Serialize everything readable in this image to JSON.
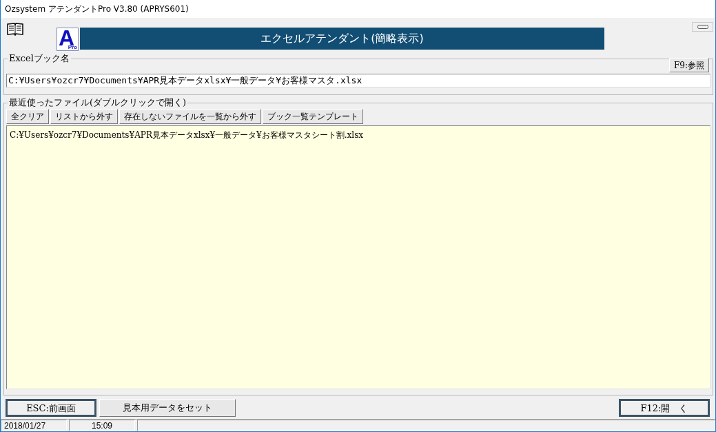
{
  "window": {
    "title": "Ozsystem アテンダントPro V3.80 (APRYS601)"
  },
  "logo": {
    "letter": "A",
    "sub": "Pro"
  },
  "banner": {
    "title": "エクセルアテンダント(簡略表示)"
  },
  "excel_book": {
    "legend": "Excelブック名",
    "browse_button": "F9:参照",
    "value": "C:¥Users¥ozcr7¥Documents¥APR見本データxlsx¥一般データ¥お客様マスタ.xlsx"
  },
  "recent_files": {
    "legend": "最近使ったファイル(ダブルクリックで開く)",
    "buttons": [
      "全クリア",
      "リストから外す",
      "存在しないファイルを一覧から外す",
      "ブック一覧テンプレート"
    ],
    "items": [
      {
        "path": "C:¥Users¥ozcr7¥Documents¥APR見本データxlsx¥一般データ¥お客様マスタシート割.xlsx",
        "selected": false
      }
    ]
  },
  "footer_buttons": [
    {
      "label": "ESC:前画面",
      "default": true
    },
    {
      "label": "見本用データをセット",
      "default": false
    },
    {
      "label": "F12:開　く",
      "default": true
    }
  ],
  "status_bar": {
    "date": "2018/01/27",
    "time": "15:09"
  }
}
